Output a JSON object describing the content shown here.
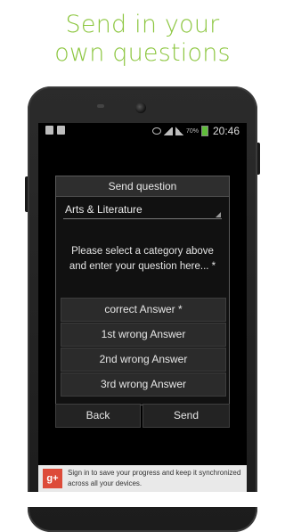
{
  "promo": {
    "line1": "Send in your",
    "line2": "own questions"
  },
  "statusbar": {
    "battery_percent": "70%",
    "time": "20:46"
  },
  "dialog": {
    "title": "Send question",
    "category": "Arts & Literature",
    "prompt": "Please select a category above and enter your question here... *",
    "answers": [
      {
        "label": "correct Answer *"
      },
      {
        "label": "1st wrong Answer"
      },
      {
        "label": "2nd wrong Answer"
      },
      {
        "label": "3rd wrong Answer"
      }
    ]
  },
  "buttons": {
    "back": "Back",
    "send": "Send"
  },
  "signin_banner": {
    "icon_text": "g+",
    "text": "Sign in to save your progress and keep it synchronized across all your devices."
  },
  "colors": {
    "promo_green": "#8cc63f",
    "gplus_red": "#dd4b39",
    "battery_green": "#5fbd3a"
  }
}
